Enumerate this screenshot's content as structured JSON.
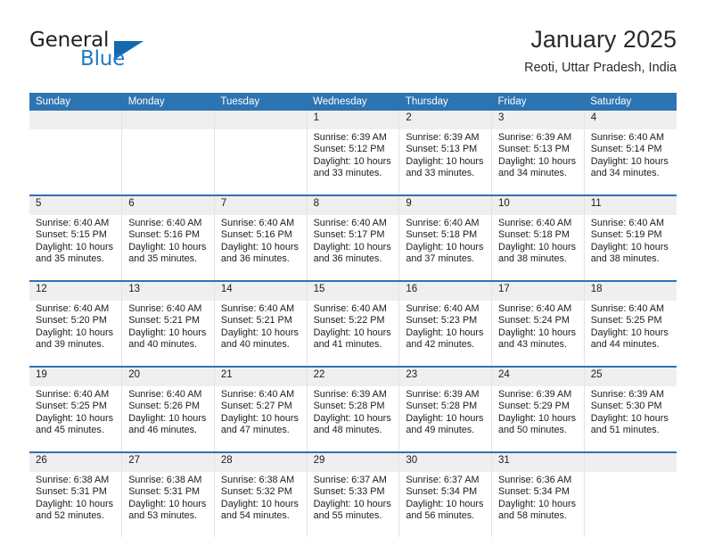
{
  "brand": {
    "name_top": "General",
    "name_bottom": "Blue",
    "triangle_color": "#1269b0",
    "blue_text_color": "#1d7bc4"
  },
  "header": {
    "title": "January 2025",
    "subtitle": "Reoti, Uttar Pradesh, India"
  },
  "theme": {
    "header_blue": "#2d74b3",
    "daynum_band": "#efefef",
    "cell_border": "#e3e3e3"
  },
  "weekdays": [
    "Sunday",
    "Monday",
    "Tuesday",
    "Wednesday",
    "Thursday",
    "Friday",
    "Saturday"
  ],
  "weeks": [
    [
      {
        "day": "",
        "sunrise": "",
        "sunset": "",
        "daylight1": "",
        "daylight2": ""
      },
      {
        "day": "",
        "sunrise": "",
        "sunset": "",
        "daylight1": "",
        "daylight2": ""
      },
      {
        "day": "",
        "sunrise": "",
        "sunset": "",
        "daylight1": "",
        "daylight2": ""
      },
      {
        "day": "1",
        "sunrise": "Sunrise: 6:39 AM",
        "sunset": "Sunset: 5:12 PM",
        "daylight1": "Daylight: 10 hours",
        "daylight2": "and 33 minutes."
      },
      {
        "day": "2",
        "sunrise": "Sunrise: 6:39 AM",
        "sunset": "Sunset: 5:13 PM",
        "daylight1": "Daylight: 10 hours",
        "daylight2": "and 33 minutes."
      },
      {
        "day": "3",
        "sunrise": "Sunrise: 6:39 AM",
        "sunset": "Sunset: 5:13 PM",
        "daylight1": "Daylight: 10 hours",
        "daylight2": "and 34 minutes."
      },
      {
        "day": "4",
        "sunrise": "Sunrise: 6:40 AM",
        "sunset": "Sunset: 5:14 PM",
        "daylight1": "Daylight: 10 hours",
        "daylight2": "and 34 minutes."
      }
    ],
    [
      {
        "day": "5",
        "sunrise": "Sunrise: 6:40 AM",
        "sunset": "Sunset: 5:15 PM",
        "daylight1": "Daylight: 10 hours",
        "daylight2": "and 35 minutes."
      },
      {
        "day": "6",
        "sunrise": "Sunrise: 6:40 AM",
        "sunset": "Sunset: 5:16 PM",
        "daylight1": "Daylight: 10 hours",
        "daylight2": "and 35 minutes."
      },
      {
        "day": "7",
        "sunrise": "Sunrise: 6:40 AM",
        "sunset": "Sunset: 5:16 PM",
        "daylight1": "Daylight: 10 hours",
        "daylight2": "and 36 minutes."
      },
      {
        "day": "8",
        "sunrise": "Sunrise: 6:40 AM",
        "sunset": "Sunset: 5:17 PM",
        "daylight1": "Daylight: 10 hours",
        "daylight2": "and 36 minutes."
      },
      {
        "day": "9",
        "sunrise": "Sunrise: 6:40 AM",
        "sunset": "Sunset: 5:18 PM",
        "daylight1": "Daylight: 10 hours",
        "daylight2": "and 37 minutes."
      },
      {
        "day": "10",
        "sunrise": "Sunrise: 6:40 AM",
        "sunset": "Sunset: 5:18 PM",
        "daylight1": "Daylight: 10 hours",
        "daylight2": "and 38 minutes."
      },
      {
        "day": "11",
        "sunrise": "Sunrise: 6:40 AM",
        "sunset": "Sunset: 5:19 PM",
        "daylight1": "Daylight: 10 hours",
        "daylight2": "and 38 minutes."
      }
    ],
    [
      {
        "day": "12",
        "sunrise": "Sunrise: 6:40 AM",
        "sunset": "Sunset: 5:20 PM",
        "daylight1": "Daylight: 10 hours",
        "daylight2": "and 39 minutes."
      },
      {
        "day": "13",
        "sunrise": "Sunrise: 6:40 AM",
        "sunset": "Sunset: 5:21 PM",
        "daylight1": "Daylight: 10 hours",
        "daylight2": "and 40 minutes."
      },
      {
        "day": "14",
        "sunrise": "Sunrise: 6:40 AM",
        "sunset": "Sunset: 5:21 PM",
        "daylight1": "Daylight: 10 hours",
        "daylight2": "and 40 minutes."
      },
      {
        "day": "15",
        "sunrise": "Sunrise: 6:40 AM",
        "sunset": "Sunset: 5:22 PM",
        "daylight1": "Daylight: 10 hours",
        "daylight2": "and 41 minutes."
      },
      {
        "day": "16",
        "sunrise": "Sunrise: 6:40 AM",
        "sunset": "Sunset: 5:23 PM",
        "daylight1": "Daylight: 10 hours",
        "daylight2": "and 42 minutes."
      },
      {
        "day": "17",
        "sunrise": "Sunrise: 6:40 AM",
        "sunset": "Sunset: 5:24 PM",
        "daylight1": "Daylight: 10 hours",
        "daylight2": "and 43 minutes."
      },
      {
        "day": "18",
        "sunrise": "Sunrise: 6:40 AM",
        "sunset": "Sunset: 5:25 PM",
        "daylight1": "Daylight: 10 hours",
        "daylight2": "and 44 minutes."
      }
    ],
    [
      {
        "day": "19",
        "sunrise": "Sunrise: 6:40 AM",
        "sunset": "Sunset: 5:25 PM",
        "daylight1": "Daylight: 10 hours",
        "daylight2": "and 45 minutes."
      },
      {
        "day": "20",
        "sunrise": "Sunrise: 6:40 AM",
        "sunset": "Sunset: 5:26 PM",
        "daylight1": "Daylight: 10 hours",
        "daylight2": "and 46 minutes."
      },
      {
        "day": "21",
        "sunrise": "Sunrise: 6:40 AM",
        "sunset": "Sunset: 5:27 PM",
        "daylight1": "Daylight: 10 hours",
        "daylight2": "and 47 minutes."
      },
      {
        "day": "22",
        "sunrise": "Sunrise: 6:39 AM",
        "sunset": "Sunset: 5:28 PM",
        "daylight1": "Daylight: 10 hours",
        "daylight2": "and 48 minutes."
      },
      {
        "day": "23",
        "sunrise": "Sunrise: 6:39 AM",
        "sunset": "Sunset: 5:28 PM",
        "daylight1": "Daylight: 10 hours",
        "daylight2": "and 49 minutes."
      },
      {
        "day": "24",
        "sunrise": "Sunrise: 6:39 AM",
        "sunset": "Sunset: 5:29 PM",
        "daylight1": "Daylight: 10 hours",
        "daylight2": "and 50 minutes."
      },
      {
        "day": "25",
        "sunrise": "Sunrise: 6:39 AM",
        "sunset": "Sunset: 5:30 PM",
        "daylight1": "Daylight: 10 hours",
        "daylight2": "and 51 minutes."
      }
    ],
    [
      {
        "day": "26",
        "sunrise": "Sunrise: 6:38 AM",
        "sunset": "Sunset: 5:31 PM",
        "daylight1": "Daylight: 10 hours",
        "daylight2": "and 52 minutes."
      },
      {
        "day": "27",
        "sunrise": "Sunrise: 6:38 AM",
        "sunset": "Sunset: 5:31 PM",
        "daylight1": "Daylight: 10 hours",
        "daylight2": "and 53 minutes."
      },
      {
        "day": "28",
        "sunrise": "Sunrise: 6:38 AM",
        "sunset": "Sunset: 5:32 PM",
        "daylight1": "Daylight: 10 hours",
        "daylight2": "and 54 minutes."
      },
      {
        "day": "29",
        "sunrise": "Sunrise: 6:37 AM",
        "sunset": "Sunset: 5:33 PM",
        "daylight1": "Daylight: 10 hours",
        "daylight2": "and 55 minutes."
      },
      {
        "day": "30",
        "sunrise": "Sunrise: 6:37 AM",
        "sunset": "Sunset: 5:34 PM",
        "daylight1": "Daylight: 10 hours",
        "daylight2": "and 56 minutes."
      },
      {
        "day": "31",
        "sunrise": "Sunrise: 6:36 AM",
        "sunset": "Sunset: 5:34 PM",
        "daylight1": "Daylight: 10 hours",
        "daylight2": "and 58 minutes."
      },
      {
        "day": "",
        "sunrise": "",
        "sunset": "",
        "daylight1": "",
        "daylight2": ""
      }
    ]
  ]
}
